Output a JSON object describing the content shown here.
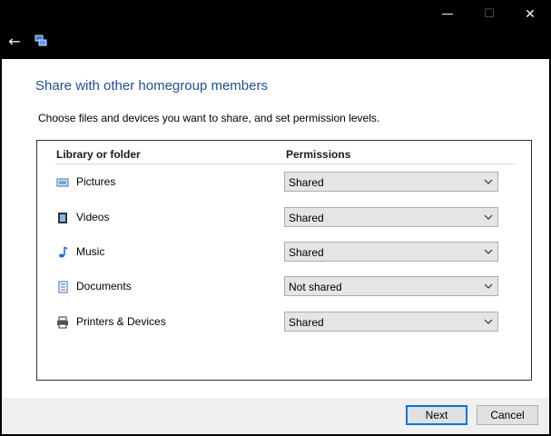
{
  "window": {
    "caption": {
      "minimize": "—",
      "maximize": "☐",
      "close": "✕"
    }
  },
  "nav": {
    "back": "←",
    "icon": "homegroup-icon"
  },
  "heading": "Share with other homegroup members",
  "instructions": "Choose files and devices you want to share, and set permission levels.",
  "table": {
    "headers": {
      "library": "Library or folder",
      "permissions": "Permissions"
    },
    "rows": [
      {
        "label": "Pictures",
        "value": "Shared",
        "icon": "pictures-icon"
      },
      {
        "label": "Videos",
        "value": "Shared",
        "icon": "videos-icon"
      },
      {
        "label": "Music",
        "value": "Shared",
        "icon": "music-icon"
      },
      {
        "label": "Documents",
        "value": "Not shared",
        "icon": "documents-icon"
      },
      {
        "label": "Printers & Devices",
        "value": "Shared",
        "icon": "printers-icon"
      }
    ]
  },
  "footer": {
    "next": "Next",
    "cancel": "Cancel"
  },
  "colors": {
    "heading": "#1f4e99",
    "accent": "#0078d7",
    "titlebar": "#000000"
  }
}
